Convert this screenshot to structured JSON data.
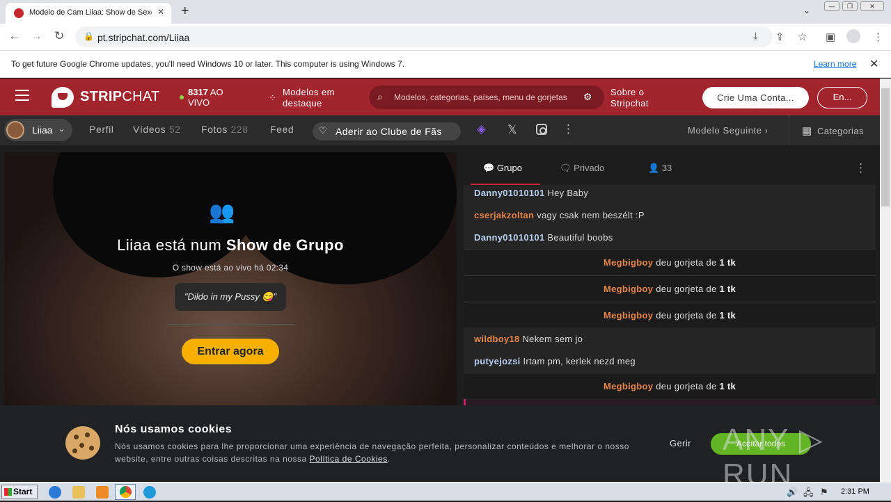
{
  "browser": {
    "tab_title": "Modelo de Cam Liiaa: Show de Sexo",
    "url": "pt.stripchat.com/Liiaa",
    "infobar_text": "To get future Google Chrome updates, you'll need Windows 10 or later. This computer is using Windows 7.",
    "learn_more": "Learn more"
  },
  "header": {
    "logo_bold": "STRIP",
    "logo_rest": "CHAT",
    "live_count": "8317",
    "live_label": "AO VIVO",
    "featured": "Modelos em destaque",
    "search_placeholder": "Modelos, categorias, países, menu de gorjetas",
    "about": "Sobre o Stripchat",
    "signup": "Crie Uma Conta...",
    "login": "En..."
  },
  "subnav": {
    "model_name": "Liiaa",
    "profile": "Perfil",
    "videos": "Vídeos",
    "videos_count": "52",
    "photos": "Fotos",
    "photos_count": "228",
    "feed": "Feed",
    "fanclub": "Aderir ao Clube de Fãs",
    "next_model": "Modelo Seguinte",
    "categories": "Categorias"
  },
  "video": {
    "show_prefix": "Liiaa está num",
    "show_type": "Show de Grupo",
    "live_since": "O show está ao vivo há 02:34",
    "topic": "\"Dildo in my Pussy 😋\"",
    "join_button": "Entrar agora"
  },
  "chat": {
    "tab_group": "Grupo",
    "tab_private": "Privado",
    "users_count": "33",
    "tip_text": "deu gorjeta de",
    "tip_amount": "1 tk",
    "messages": [
      {
        "user": "Danny01010101",
        "text": "Hey Baby",
        "color": "#b9cff0"
      },
      {
        "user": "cserjakzoltan",
        "text": "vagy csak nem beszélt :P",
        "color": "#e8864a"
      },
      {
        "user": "Danny01010101",
        "text": "Beautiful boobs",
        "color": "#b9cff0"
      },
      {
        "user": "wildboy18",
        "text": "Nekem sem jo",
        "color": "#e8864a"
      },
      {
        "user": "putyejozsi",
        "text": "Irtam pm, kerlek nezd meg",
        "color": "#b9cff0"
      }
    ],
    "tipper": "Megbigboy"
  },
  "cookies": {
    "title": "Nós usamos cookies",
    "text": "Nós usamos cookies para lhe proporcionar uma experiência de navegação perfeita, personalizar conteúdos e melhorar o nosso website, entre outras coisas descritas na nossa",
    "link": "Política de Cookies",
    "manage": "Gerir",
    "accept": "Aceitar todos"
  },
  "watermark": "ANY ▷ RUN",
  "taskbar": {
    "start": "Start",
    "clock": "2:31 PM"
  }
}
